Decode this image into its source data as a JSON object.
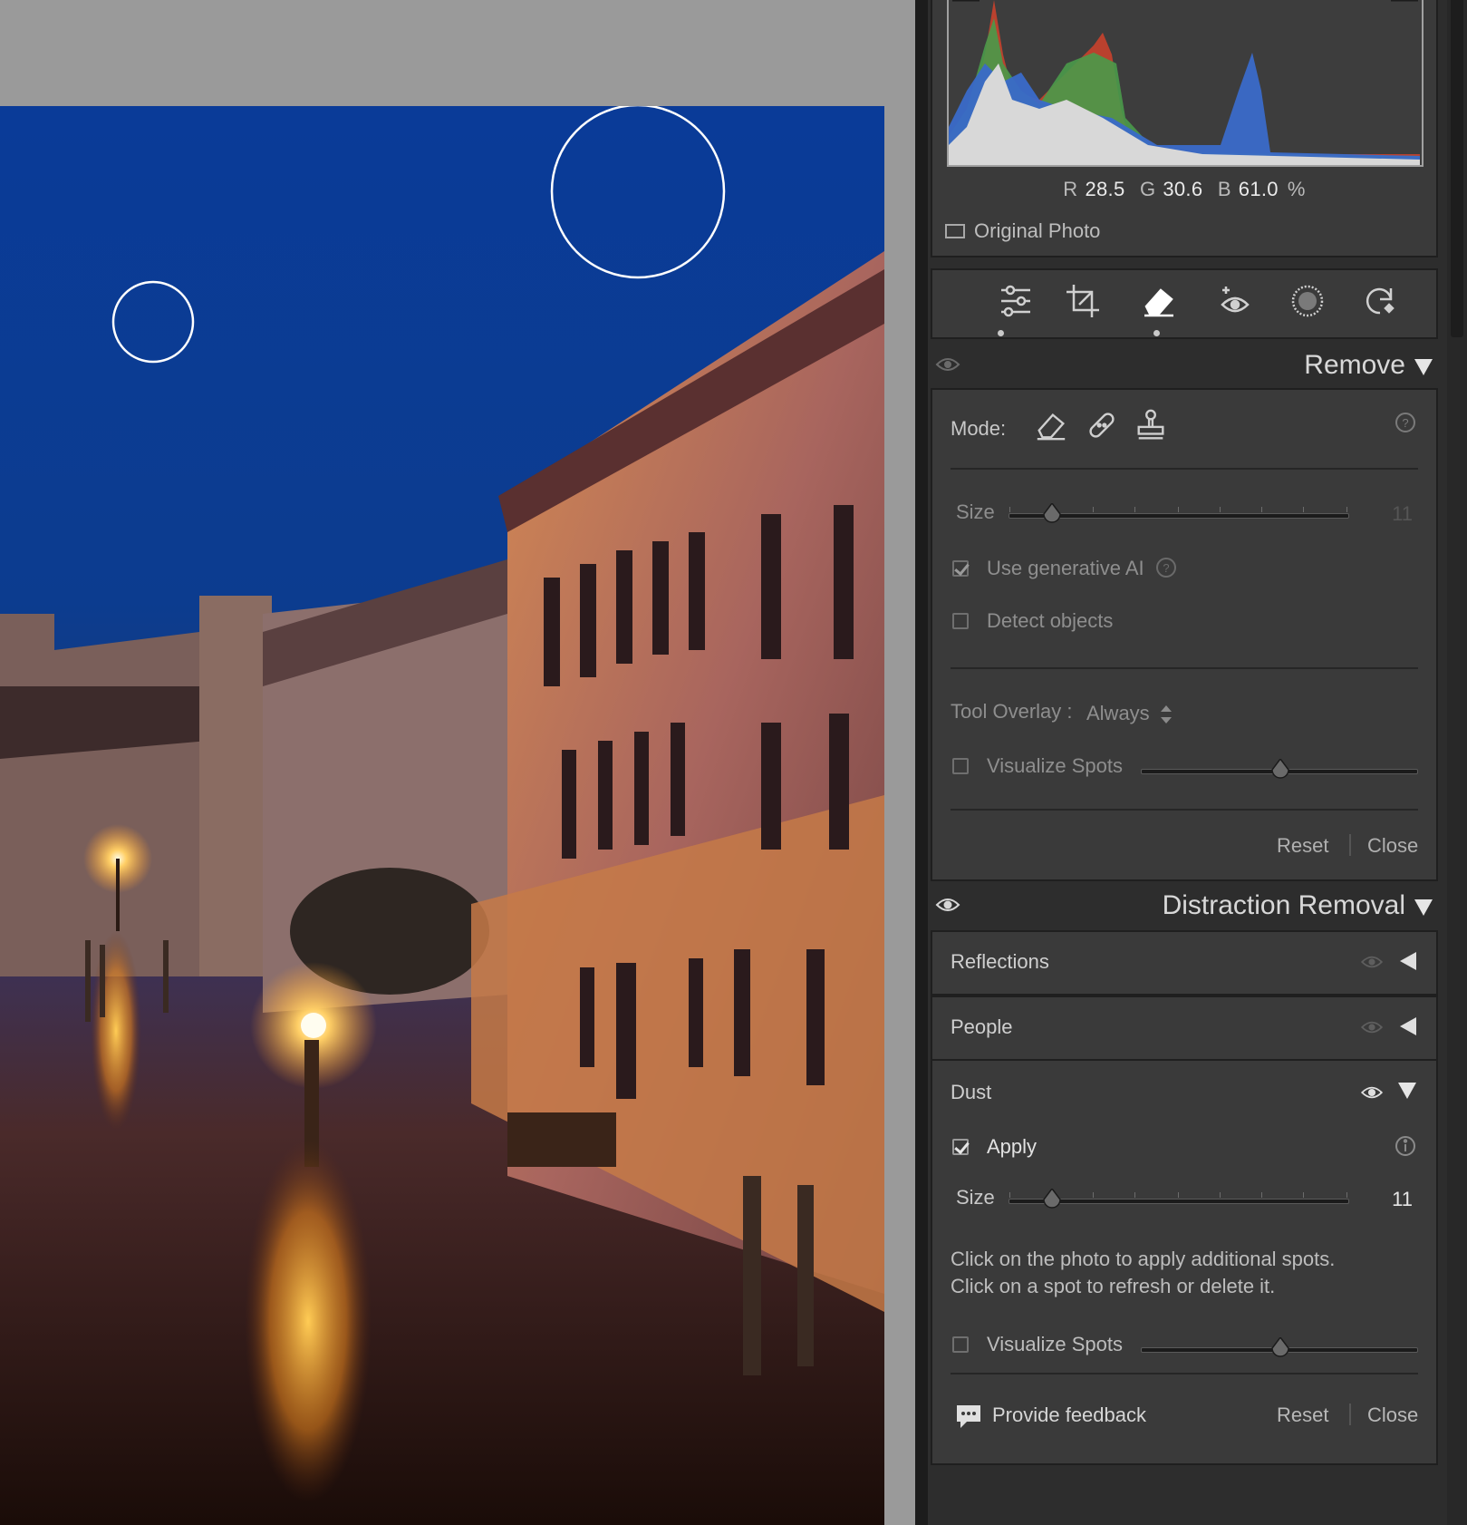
{
  "histogram": {
    "r_label": "R",
    "r_value": "28.5",
    "g_label": "G",
    "g_value": "30.6",
    "b_label": "B",
    "b_value": "61.0",
    "unit": "%",
    "original_photo_label": "Original Photo"
  },
  "toolstrip": {
    "tools": [
      "edit-sliders-icon",
      "crop-icon",
      "remove-eraser-icon",
      "red-eye-icon",
      "masking-icon",
      "presets-icon"
    ],
    "active": "remove-eraser-icon"
  },
  "remove": {
    "title": "Remove",
    "mode_label": "Mode:",
    "size_label": "Size",
    "size_value": "11",
    "generative_ai_label": "Use generative AI",
    "generative_ai_checked": true,
    "detect_objects_label": "Detect objects",
    "detect_objects_checked": false,
    "tool_overlay_label": "Tool Overlay :",
    "tool_overlay_value": "Always",
    "visualize_spots_label": "Visualize Spots",
    "visualize_spots_checked": false,
    "reset_label": "Reset",
    "close_label": "Close"
  },
  "distraction": {
    "title": "Distraction Removal",
    "reflections_label": "Reflections",
    "people_label": "People",
    "dust_label": "Dust",
    "apply_label": "Apply",
    "apply_checked": true,
    "size_label": "Size",
    "size_value": "11",
    "help_line1": "Click on the photo to apply additional spots.",
    "help_line2": "Click on a spot to refresh or delete it.",
    "visualize_spots_label": "Visualize Spots",
    "visualize_spots_checked": false,
    "feedback_label": "Provide feedback",
    "reset_label": "Reset",
    "close_label": "Close"
  },
  "colors": {
    "panel_bg": "#2d2d2d",
    "section_bg": "#3a3a3a",
    "canvas_gray": "#9a9a9a",
    "sky_blue": "#0b3f99",
    "lamp_orange": "#ffb347"
  }
}
